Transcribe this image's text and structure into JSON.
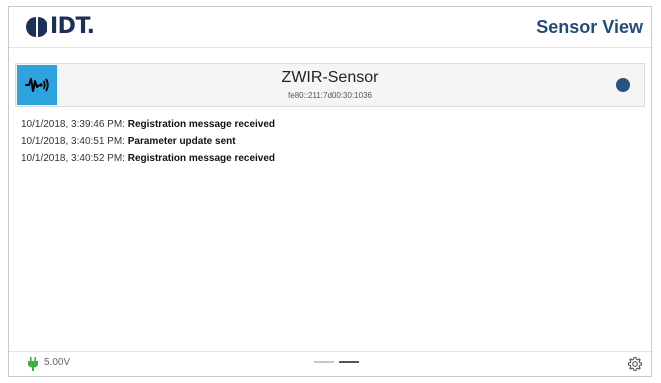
{
  "header": {
    "logo_text": "IDT.",
    "title": "Sensor View"
  },
  "sensor": {
    "name": "ZWIR-Sensor",
    "address": "fe80::211:7d00:30:1036",
    "icon": "signal-wave-icon",
    "status_color": "#24557f"
  },
  "log": [
    {
      "timestamp": "10/1/2018, 3:39:46 PM:",
      "message": "Registration message received"
    },
    {
      "timestamp": "10/1/2018, 3:40:51 PM:",
      "message": "Parameter update sent"
    },
    {
      "timestamp": "10/1/2018, 3:40:52 PM:",
      "message": "Registration message received"
    }
  ],
  "footer": {
    "voltage": "5.00V",
    "power_icon": "plug-icon",
    "settings_icon": "gear-icon",
    "page_count": 2,
    "active_page": 2
  },
  "colors": {
    "accent": "#2ea3e0",
    "brand": "#1b2f57",
    "title": "#244b7a",
    "power": "#3cb043"
  }
}
